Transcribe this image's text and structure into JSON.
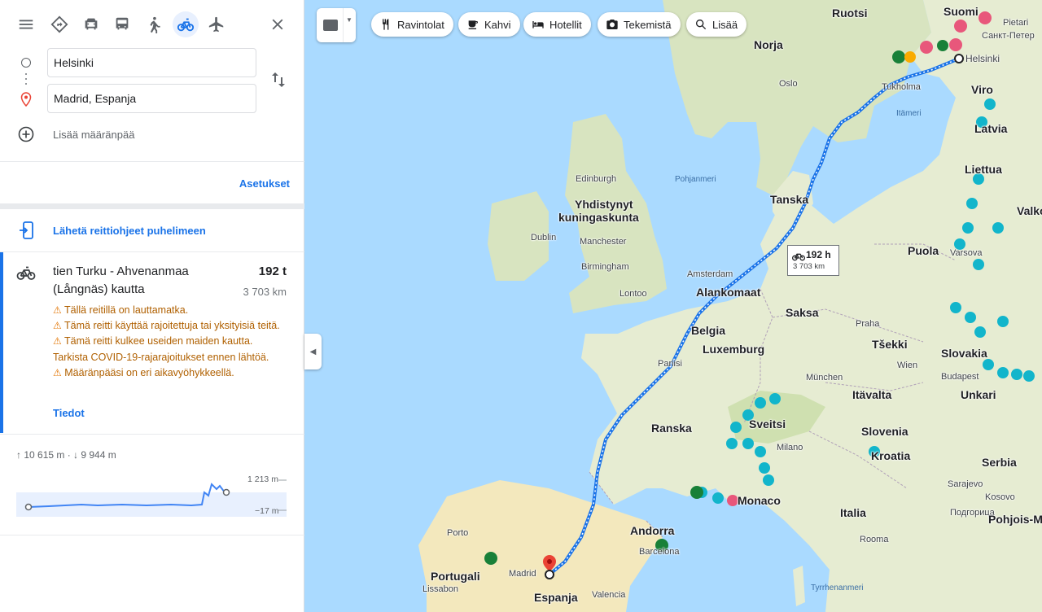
{
  "travel_modes": [
    {
      "name": "best-mode",
      "icon": "diamond-route-icon"
    },
    {
      "name": "drive",
      "icon": "car-icon"
    },
    {
      "name": "transit",
      "icon": "bus-icon"
    },
    {
      "name": "walk",
      "icon": "walk-icon"
    },
    {
      "name": "bicycle",
      "icon": "bicycle-icon",
      "active": true
    },
    {
      "name": "flight",
      "icon": "airplane-icon"
    }
  ],
  "origin": {
    "value": "Helsinki"
  },
  "destination": {
    "value": "Madrid, Espanja"
  },
  "add_destination_label": "Lisää määränpää",
  "options_label": "Asetukset",
  "send_to_phone_label": "Lähetä reittiohjeet puhelimeen",
  "route": {
    "title": "tien Turku - Ahvenanmaa (Långnäs) kautta",
    "duration": "192 t",
    "distance": "3 703 km",
    "warnings": [
      "Tällä reitillä on lauttamatka.",
      "Tämä reitti käyttää rajoitettuja tai yksityisiä teitä.",
      "Tämä reitti kulkee useiden maiden kautta. Tarkista COVID-19-rajarajoitukset ennen lähtöä.",
      "Määränpääsi on eri aikavyöhykkeellä."
    ],
    "details_label": "Tiedot"
  },
  "elevation": {
    "summary": "↑ 10 615 m · ↓ 9 944 m",
    "max_label": "1 213 m",
    "min_label": "−17 m"
  },
  "map": {
    "chips": [
      {
        "label": "Ravintolat",
        "icon": "restaurant-icon"
      },
      {
        "label": "Kahvi",
        "icon": "coffee-icon"
      },
      {
        "label": "Hotellit",
        "icon": "hotel-icon"
      },
      {
        "label": "Tekemistä",
        "icon": "camera-icon"
      },
      {
        "label": "Lisää",
        "icon": "search-icon"
      }
    ],
    "route_tooltip": {
      "time": "192 h",
      "distance": "3 703 km"
    },
    "labels": {
      "ruotsi": "Ruotsi",
      "suomi": "Suomi",
      "pietari": "Pietari",
      "sankt": "Санкт-Петер",
      "helsinki": "Helsinki",
      "norja": "Norja",
      "oslo": "Oslo",
      "tukholma": "Tukholma",
      "viro": "Viro",
      "itameri": "Itämeri",
      "latvia": "Latvia",
      "pohjanmeri": "Pohjanmeri",
      "liettua": "Liettua",
      "tanska": "Tanska",
      "edinburgh": "Edinburgh",
      "yhdistynyt": "Yhdistynyt",
      "kuningaskunta": "kuningaskunta",
      "dublin": "Dublin",
      "manchester": "Manchester",
      "birmingham": "Birmingham",
      "lontoo": "Lontoo",
      "amsterdam": "Amsterdam",
      "alankomaat": "Alankomaat",
      "saksa": "Saksa",
      "puola": "Puola",
      "varsova": "Varsova",
      "valko": "Valko",
      "belgia": "Belgia",
      "luxemburg": "Luxemburg",
      "praha": "Praha",
      "tsekki": "Tšekki",
      "pariisi": "Pariisi",
      "slovakia": "Slovakia",
      "wien": "Wien",
      "munchen": "München",
      "budapest": "Budapest",
      "unkari": "Unkari",
      "itavalta": "Itävalta",
      "ranska": "Ranska",
      "sveitsi": "Sveitsi",
      "slovenia": "Slovenia",
      "kroatia": "Kroatia",
      "milano": "Milano",
      "serbia": "Serbia",
      "sarajevo": "Sarajevo",
      "kosovo": "Kosovo",
      "podgorica": "Подгорица",
      "pohjois": "Pohjois-Make",
      "monaco": "Monaco",
      "italia": "Italia",
      "andorra": "Andorra",
      "roomaa": "Rooma",
      "porto": "Porto",
      "portugali": "Portugali",
      "lissabon": "Lissabon",
      "madrid": "Madrid",
      "espanja": "Espanja",
      "valencia": "Valencia",
      "barcelona": "Barcelona",
      "tyrrhenanmeri": "Tyrrhenanmeri"
    }
  },
  "colors": {
    "accent": "#1a73e8",
    "warning": "#b06000",
    "land": "#e6ecd2",
    "water": "#aadaff",
    "route": "#4285f4",
    "pin_teal": "#12b5cb",
    "pin_pink": "#e8577b",
    "pin_green": "#188038",
    "destination_pin": "#ea4335"
  }
}
